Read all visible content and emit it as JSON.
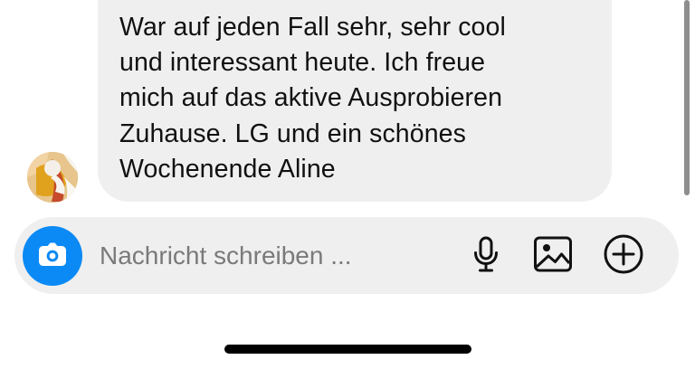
{
  "message": {
    "lines": [
      "War auf jeden Fall sehr, sehr cool",
      "und interessant heute. Ich freue",
      "mich auf das aktive Ausprobieren",
      "Zuhause. LG und ein schönes",
      "Wochenende Aline"
    ]
  },
  "composer": {
    "placeholder": "Nachricht schreiben ...",
    "camera_icon": "camera-icon",
    "mic_icon": "microphone-icon",
    "gallery_icon": "image-icon",
    "plus_icon": "plus-circle-icon"
  },
  "colors": {
    "accent": "#0b8af5",
    "bubble": "#efefef",
    "composer": "#efefef",
    "text": "#111111",
    "placeholder": "#7a7a7a"
  }
}
